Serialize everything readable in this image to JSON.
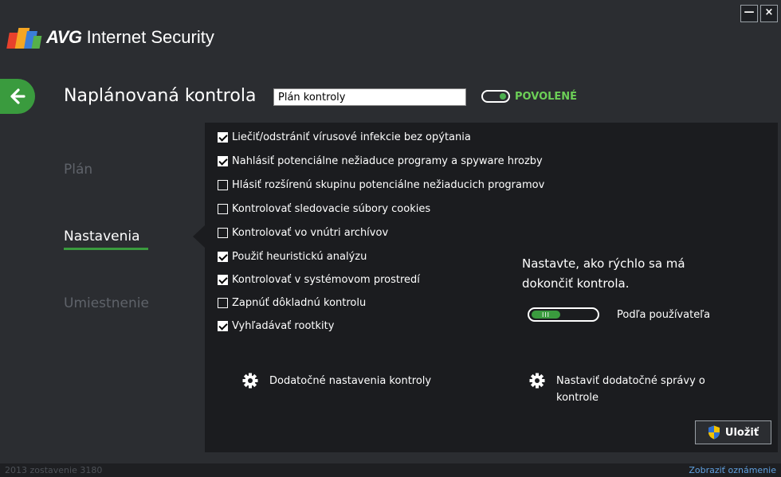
{
  "window": {
    "minimize_label": "—",
    "close_label": "×"
  },
  "app": {
    "brand": "AVG",
    "product": " Internet Security"
  },
  "header": {
    "title": "Naplánovaná kontrola",
    "name_value": "Plán kontroly",
    "status_label": "POVOLENÉ",
    "status_enabled": true
  },
  "sidebar": {
    "items": [
      {
        "label": "Plán",
        "active": false
      },
      {
        "label": "Nastavenia",
        "active": true
      },
      {
        "label": "Umiestnenie",
        "active": false
      }
    ]
  },
  "options": [
    {
      "label": "Liečiť/odstrániť vírusové infekcie bez opýtania",
      "checked": true
    },
    {
      "label": "Nahlásiť potenciálne nežiaduce programy a spyware hrozby",
      "checked": true
    },
    {
      "label": "Hlásiť rozšírenú skupinu potenciálne nežiaducich programov",
      "checked": false
    },
    {
      "label": "Kontrolovať sledovacie súbory cookies",
      "checked": false
    },
    {
      "label": "Kontrolovať vo vnútri archívov",
      "checked": false
    },
    {
      "label": "Použiť heuristickú analýzu",
      "checked": true
    },
    {
      "label": "Kontrolovať v systémovom prostredí",
      "checked": true
    },
    {
      "label": "Zapnúť dôkladnú kontrolu",
      "checked": false
    },
    {
      "label": "Vyhľadávať rootkity",
      "checked": true
    }
  ],
  "speed": {
    "line1": "Nastavte, ako rýchlo sa má",
    "line2": "dokončiť kontrola.",
    "slider_grip": "III",
    "value_label": "Podľa používateľa",
    "level_fraction": 0.45
  },
  "links": {
    "extra_settings": "Dodatočné nastavenia kontroly",
    "reports_line1": "Nastaviť dodatočné správy o",
    "reports_line2": "kontrole"
  },
  "actions": {
    "save_label": "Uložiť"
  },
  "status_bar": {
    "version": "2013  zostavenie 3180",
    "notifications_link": "Zobraziť oznámenie"
  },
  "colors": {
    "accent_green": "#3a9b3e",
    "enabled_text": "#6ccf57",
    "background": "#2b2d31",
    "panel": "#1b1c1f",
    "link_blue": "#5fa0e0"
  }
}
